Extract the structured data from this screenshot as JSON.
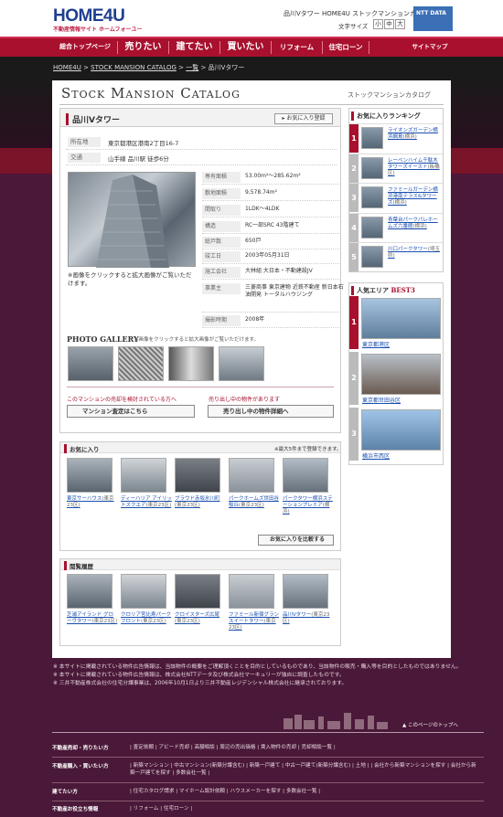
{
  "header": {
    "logo": "HOME4U",
    "logo_sub": "不動産情報サイト ホームフォーユー",
    "site_title": "品川Vタワー HOME4U ストックマンションカタログ",
    "font_size_label": "文字サイズ",
    "font_sizes": [
      "小",
      "中",
      "大"
    ],
    "group_logo": "NTT DATA"
  },
  "nav": {
    "items": [
      "総合トップページ",
      "売りたい",
      "建てたい",
      "買いたい",
      "リフォーム",
      "住宅ローン",
      "サイトマップ"
    ]
  },
  "breadcrumb": {
    "home": "HOME4U",
    "catalog": "STOCK MANSION CATALOG",
    "list": "一覧",
    "current": "品川Vタワー",
    "sep": ">"
  },
  "catalog": {
    "title": "Stock Mansion Catalog",
    "subtitle": "ストックマンションカタログ"
  },
  "property": {
    "name": "品川Vタワー",
    "fav_button": "お気に入り登録",
    "address_label": "所在地",
    "address": "東京都港区港南2丁目16-7",
    "access_label": "交通",
    "access": "山手線 品川駅 徒歩6分",
    "photo_note": "※画像をクリックすると拡大画像がご覧いただけます。",
    "specs": [
      {
        "k": "専有面積",
        "v": "53.00m²〜285.62m²"
      },
      {
        "k": "敷地面積",
        "v": "9,578.74m²"
      },
      {
        "k": "間取り",
        "v": "1LDK〜4LDK"
      },
      {
        "k": "構造",
        "v": "RC一部SRC 43階建て"
      },
      {
        "k": "総戸数",
        "v": "650戸"
      },
      {
        "k": "竣工日",
        "v": "2003年05月31日"
      },
      {
        "k": "施工会社",
        "v": "大林組 大日本・不動建設JV"
      },
      {
        "k": "事業主",
        "v": "三菱商事 東京建物 近鉄不動産 新日本石油開発 トータルハウジング"
      },
      {
        "k": "撮影時期",
        "v": "2008年"
      }
    ],
    "gallery_title": "PHOTO GALLERY",
    "gallery_note": "※画像をクリックすると拡大画像がご覧いただけます。",
    "ask_left": "このマンションの売却を検討されている方へ",
    "ask_right": "売り出し中の物件があります",
    "btn_assess": "マンション査定はこちら",
    "btn_listings": "売り出し中の物件詳細へ"
  },
  "ranking": {
    "title": "お気に入りランキング",
    "items": [
      {
        "num": "1",
        "name": "ライオンズガーデン横浜綱島",
        "area": "(横浜)"
      },
      {
        "num": "2",
        "name": "レーベンハイム千駄木タワーズイースト",
        "area": "(板橋区)"
      },
      {
        "num": "3",
        "name": "ファミールガーデン横浜港南テラス&タワーズ",
        "area": "(横浜)"
      },
      {
        "num": "4",
        "name": "青葉台パークパレホームズ六番館",
        "area": "(横浜)"
      },
      {
        "num": "5",
        "name": "川口パークタワー",
        "area": "(埼玉県)"
      }
    ]
  },
  "popular_area": {
    "title": "人気エリア",
    "best": "BEST3",
    "items": [
      {
        "num": "1",
        "name": "東京都港区"
      },
      {
        "num": "2",
        "name": "東京都世田谷区"
      },
      {
        "num": "3",
        "name": "横浜市西区"
      }
    ]
  },
  "favorites": {
    "title": "お気に入り",
    "note": "※最大5件まで登録できます。",
    "items": [
      {
        "name": "東京サーハウス",
        "area": "(東京23区)"
      },
      {
        "name": "ディーハリア アイリットスクエア",
        "area": "(東京23区)"
      },
      {
        "name": "ブラウド赤坂氷川町",
        "area": "(東京23区)"
      },
      {
        "name": "パークホームズ世田谷桜丘",
        "area": "(東京23区)"
      },
      {
        "name": "パークタワー横浜ステーションプレミア",
        "area": "(横浜)"
      }
    ],
    "compare_button": "お気に入りを比較する"
  },
  "history": {
    "title": "閲覧履歴",
    "items": [
      {
        "name": "芝浦アイランド グローヴタワー",
        "area": "(東京23区)"
      },
      {
        "name": "クロリア宮比寿パークフロント",
        "area": "(東京23区)"
      },
      {
        "name": "クロイスターズ広尾",
        "area": "(東京23区)"
      },
      {
        "name": "ファミール新宿グランスイートタワー",
        "area": "(東京23区)"
      },
      {
        "name": "品川Vタワー",
        "area": "(東京23区)"
      }
    ]
  },
  "footer": {
    "notes": [
      "本サイトに掲載されている物件広告情報は、当該物件の概要をご理解頂くことを目的としているものであり、当該物件の販売・購入等を目的としたものではありません。",
      "本サイトに掲載されている物件広告情報は、株式会社NTTデータ及び株式会社マーキュリーが独自に調査したものです。",
      "三井不動産株式会社の住宅分譲事業は、2006年10月1日より三井不動産レジデンシャル株式会社に継承されております。"
    ],
    "to_top": "このページのトップへ",
    "rows": [
      {
        "k": "不動産売却・売りたい方",
        "v": "| 査定依頼 | アビード売却 | 高額相談 | 周辺の売出価格 | 賃入物件の売却 | 売却相談一覧 |"
      },
      {
        "k": "不動産購入・買いたい方",
        "v": "| 新築マンション | 中古マンション(新築分譲含む) | 新築一戸建て | 中古一戸建て(新築分譲含む) | 土地 |  | 会社から新築マンションを探す | 会社から新築一戸建てを探す | 多数会社一覧 |"
      },
      {
        "k": "建てたい方",
        "v": "| 住宅カタログ請求 | マイホーム設計依頼 | ハウスメーカーを探す | 多数会社一覧 |"
      },
      {
        "k": "不動産お役立ち情報",
        "v": "| リフォーム | 住宅ローン |"
      }
    ]
  },
  "colors": {
    "brand": "#a8102e",
    "link": "#1a4fb0",
    "footer_bg": "#4a1838"
  }
}
